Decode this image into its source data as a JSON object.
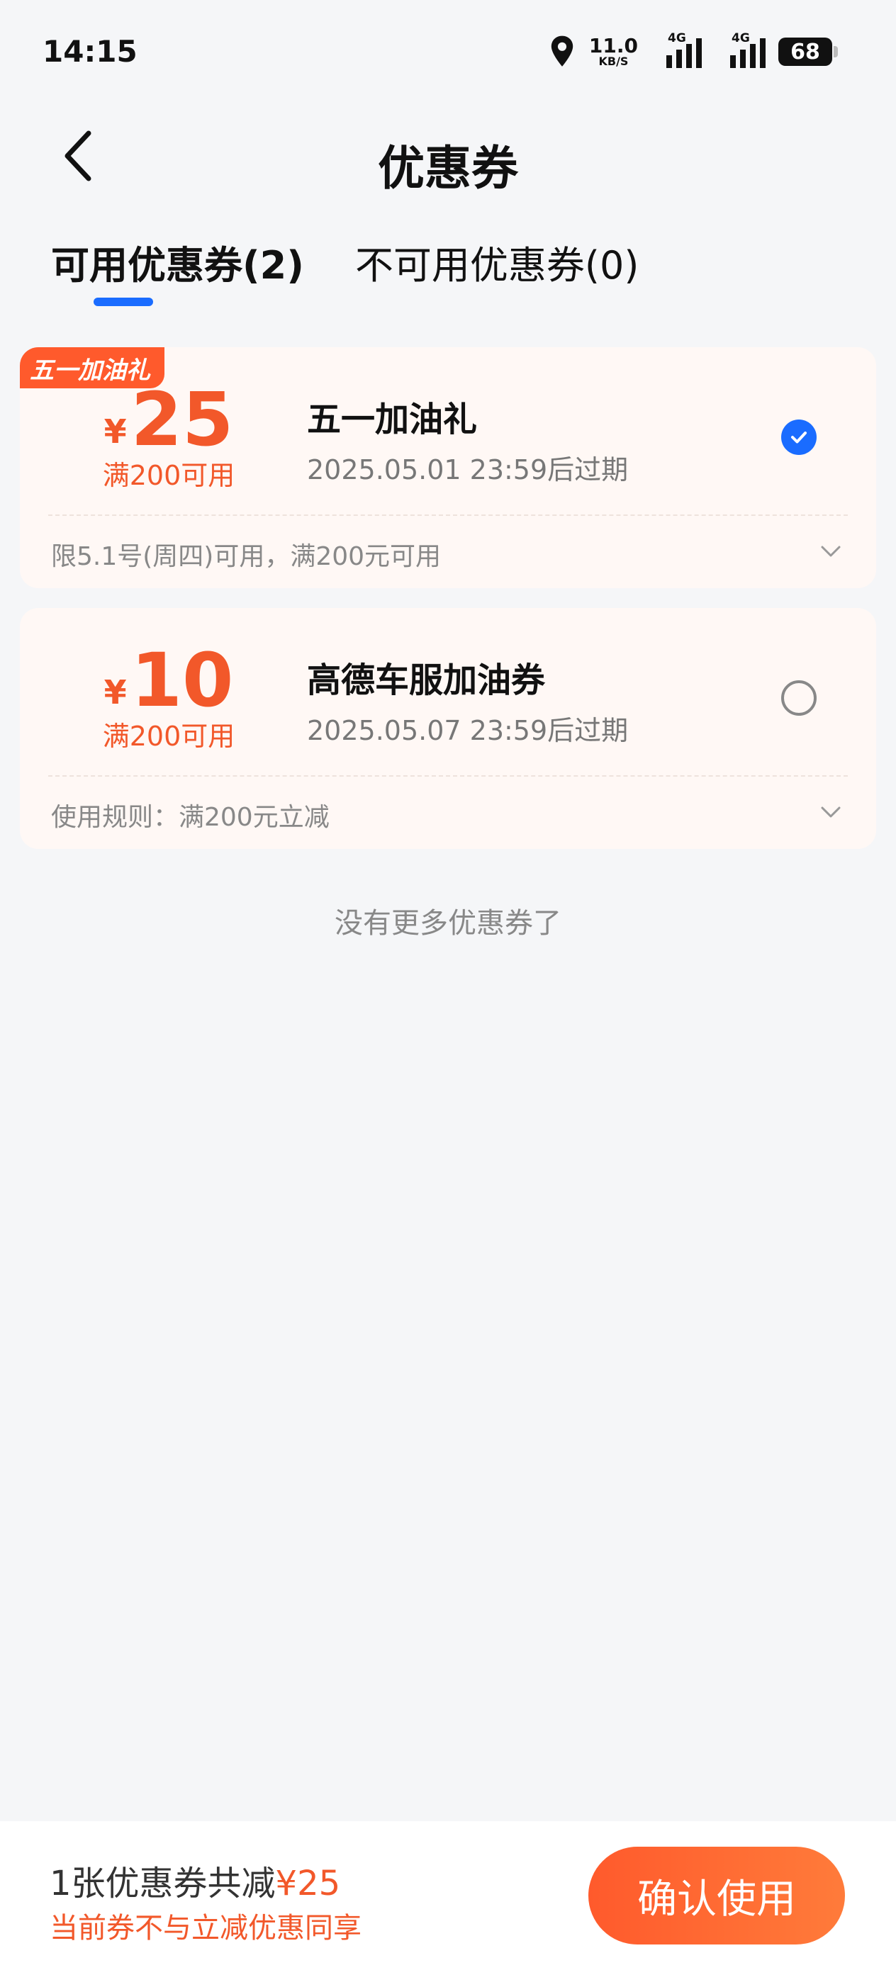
{
  "status_bar": {
    "time": "14:15",
    "net_speed_value": "11.0",
    "net_speed_unit": "KB/S",
    "signal_1_label": "4G",
    "signal_2_label": "4G",
    "battery": "68"
  },
  "header": {
    "title": "优惠券",
    "back_icon": "chevron-left-icon"
  },
  "tabs": [
    {
      "label": "可用优惠券(2)",
      "active": true
    },
    {
      "label": "不可用优惠券(0)",
      "active": false
    }
  ],
  "coupons": [
    {
      "badge": "五一加油礼",
      "currency": "¥",
      "amount": "25",
      "condition": "满200可用",
      "name": "五一加油礼",
      "expiry": "2025.05.01 23:59后过期",
      "rule": "限5.1号(周四)可用，满200元可用",
      "selected": true
    },
    {
      "badge": "",
      "currency": "¥",
      "amount": "10",
      "condition": "满200可用",
      "name": "高德车服加油券",
      "expiry": "2025.05.07 23:59后过期",
      "rule": "使用规则：满200元立减",
      "selected": false
    }
  ],
  "no_more_text": "没有更多优惠券了",
  "bottom_bar": {
    "summary_prefix": "1张优惠券共减",
    "summary_amount": "¥25",
    "note": "当前券不与立减优惠同享",
    "confirm_label": "确认使用"
  },
  "colors": {
    "accent_orange": "#f2582a",
    "accent_blue": "#1a6cff",
    "background": "#f5f6f8",
    "card_background": "#fff8f5"
  }
}
